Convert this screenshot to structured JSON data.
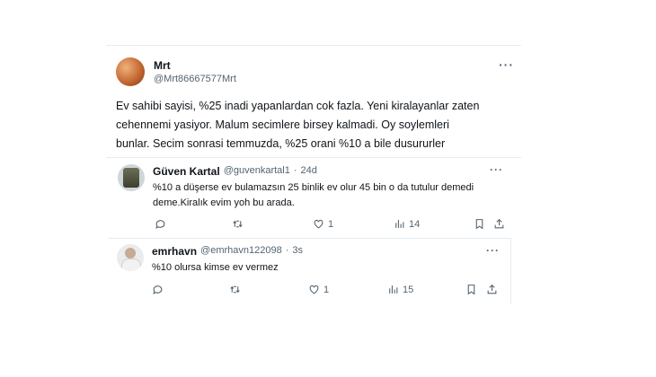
{
  "main_tweet": {
    "author_name": "Mrt",
    "author_handle": "@Mrt86667577Mrt",
    "text_lines": [
      "Ev sahibi sayisi, %25 inadi yapanlardan cok fazla. Yeni kiralayanlar zaten",
      "cehennemi yasiyor. Malum secimlere birsey kalmadi. Oy soylemleri",
      "bunlar. Secim sonrasi temmuzda, %25 orani %10 a bile dusururler"
    ]
  },
  "quoted_reply": {
    "author_name": "Güven Kartal",
    "author_handle": "@guvenkartal1",
    "separator": "·",
    "time": "24d",
    "text_lines": [
      "%10 a düşerse ev bulamazsın 25 binlik ev olur 45 bin o da tutulur demedi",
      "deme.Kiralık evim yoh bu arada."
    ],
    "likes": "1",
    "views": "14"
  },
  "bottom_reply": {
    "author_name": "emrhavn",
    "author_handle": "@emrhavn122098",
    "separator": "·",
    "time": "3s",
    "text": "%10 olursa kimse ev vermez",
    "likes": "1",
    "views": "15"
  },
  "icons": [
    "more-icon",
    "reply-icon",
    "retweet-icon",
    "like-icon",
    "views-icon",
    "bookmark-icon",
    "share-icon"
  ],
  "colors": {
    "text": "#0f1419",
    "muted": "#536471",
    "border": "#cfd9de"
  }
}
